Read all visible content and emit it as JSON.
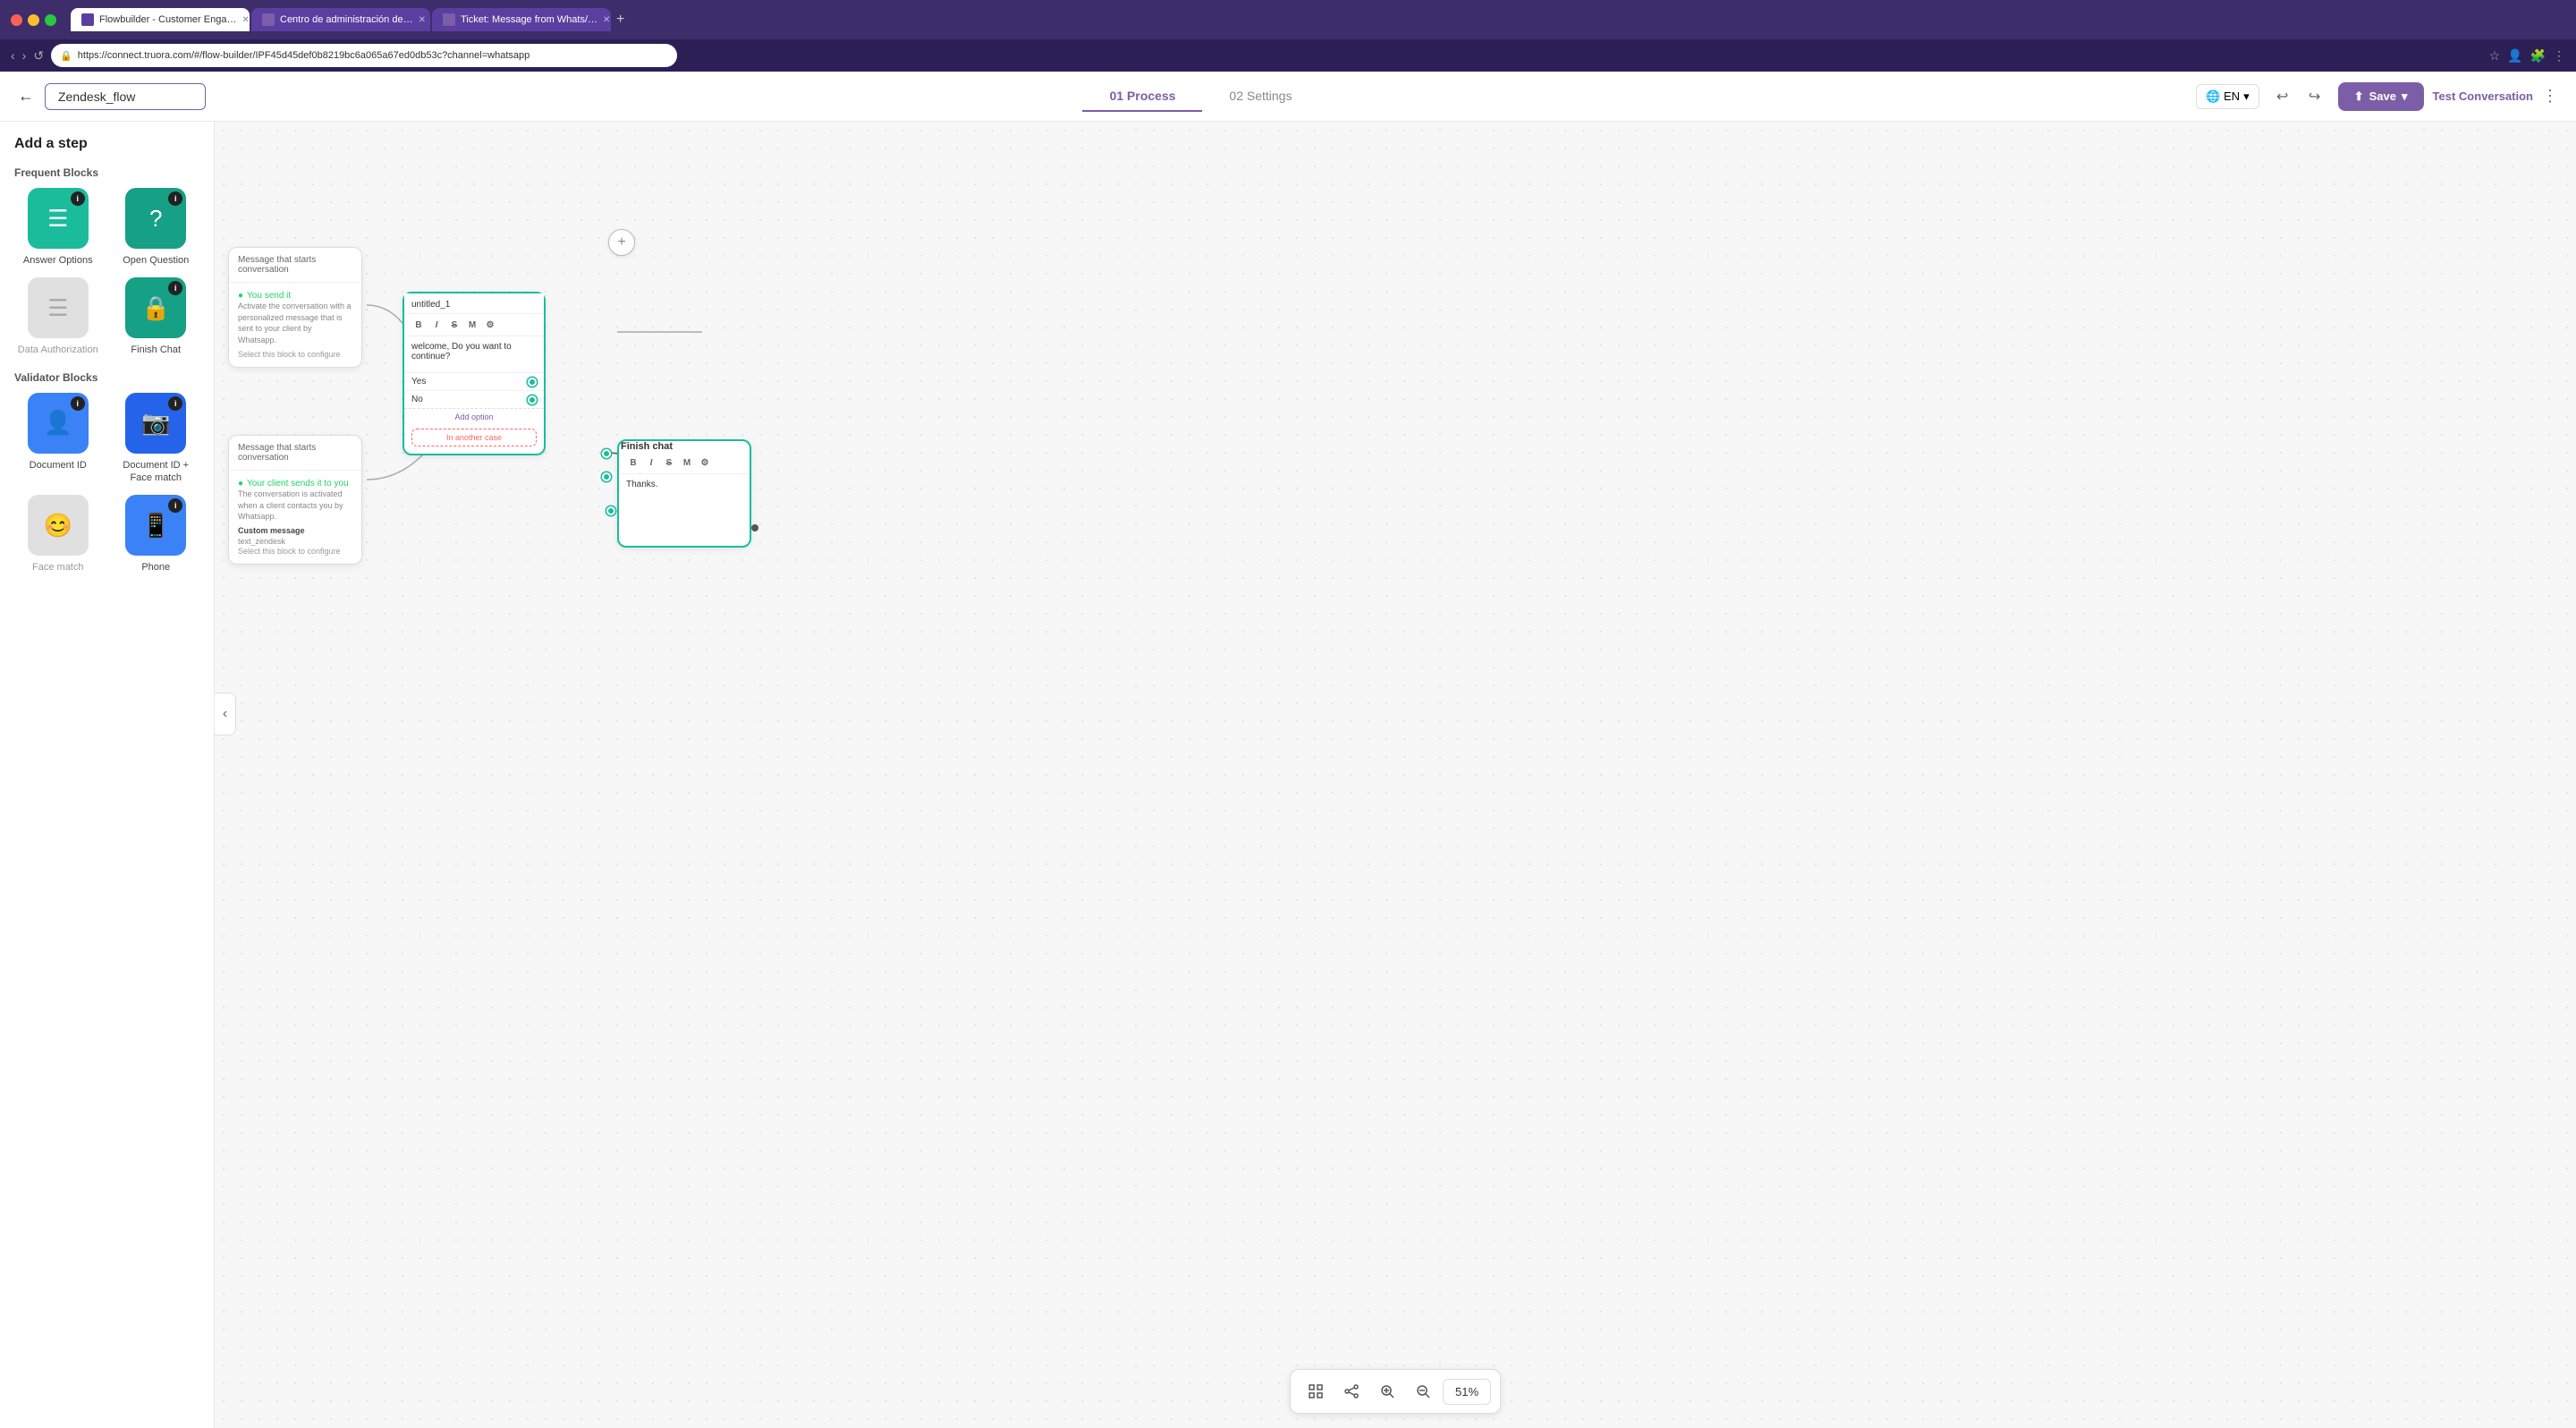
{
  "browser": {
    "tabs": [
      {
        "label": "Flowbuilder - Customer Enga…",
        "active": true,
        "favicon": "F"
      },
      {
        "label": "Centro de administración de…",
        "active": false,
        "favicon": "C"
      },
      {
        "label": "Ticket: Message from Whats/…",
        "active": false,
        "favicon": "T"
      }
    ],
    "url": "https://connect.truora.com/#/flow-builder/IPF45d45def0b8219bc6a065a67ed0db53c?channel=whatsapp"
  },
  "header": {
    "flow_name": "Zendesk_flow",
    "tab_process": "01 Process",
    "tab_settings": "02 Settings",
    "lang": "EN",
    "save_label": "Save",
    "test_label": "Test Conversation",
    "back_label": "←"
  },
  "sidebar": {
    "title": "Add a step",
    "frequent_label": "Frequent Blocks",
    "validator_label": "Validator Blocks",
    "blocks": [
      {
        "id": "answer-options",
        "label": "Answer Options",
        "color": "green",
        "icon": "☰",
        "info": true
      },
      {
        "id": "open-question",
        "label": "Open Question",
        "color": "green-dark",
        "icon": "?",
        "info": true
      },
      {
        "id": "data-authorization",
        "label": "Data Authorization",
        "color": "gray",
        "icon": "☰",
        "info": false
      },
      {
        "id": "finish-chat",
        "label": "Finish Chat",
        "color": "green-dark",
        "icon": "🔒",
        "info": true
      }
    ],
    "validator_blocks": [
      {
        "id": "document-id",
        "label": "Document ID",
        "color": "blue",
        "icon": "👤",
        "info": true
      },
      {
        "id": "document-face",
        "label": "Document ID + Face match",
        "color": "blue-dark",
        "icon": "📷",
        "info": true
      },
      {
        "id": "face-match",
        "label": "Face match",
        "color": "gray",
        "icon": "😊",
        "info": false
      },
      {
        "id": "phone",
        "label": "Phone",
        "color": "blue",
        "icon": "📱",
        "info": true
      }
    ]
  },
  "canvas": {
    "zoom": "51%",
    "nodes": {
      "start_top": {
        "header": "Message that starts conversation",
        "whatsapp_label": "You send it",
        "body": "Activate the conversation with a personalized message that is sent to your client by Whatsapp.",
        "select_text": "Select this block to configure"
      },
      "start_bottom": {
        "header": "Message that starts conversation",
        "whatsapp_label": "Your client sends it to you",
        "body": "The conversation is activated when a client contacts you by Whatsapp.",
        "custom_label": "Custom message",
        "custom_value": "text_zendesk",
        "select_text": "Select this block to configure"
      },
      "answer": {
        "title": "untitled_1",
        "toolbar": [
          "B",
          "I",
          "S",
          "M",
          "⚙"
        ],
        "text": "welcome, Do you want to continue?",
        "options": [
          {
            "label": "Yes",
            "connected": true
          },
          {
            "label": "No",
            "connected": true
          }
        ],
        "add_option": "Add option",
        "in_another_case": "In another case"
      },
      "finish_chat": {
        "title": "Finish chat",
        "toolbar": [
          "B",
          "I",
          "S",
          "M",
          "⚙"
        ],
        "text": "Thanks."
      }
    },
    "toolbar": {
      "zoom_in": "+",
      "zoom_out": "-",
      "fit": "⊡",
      "share": "⋯"
    }
  }
}
